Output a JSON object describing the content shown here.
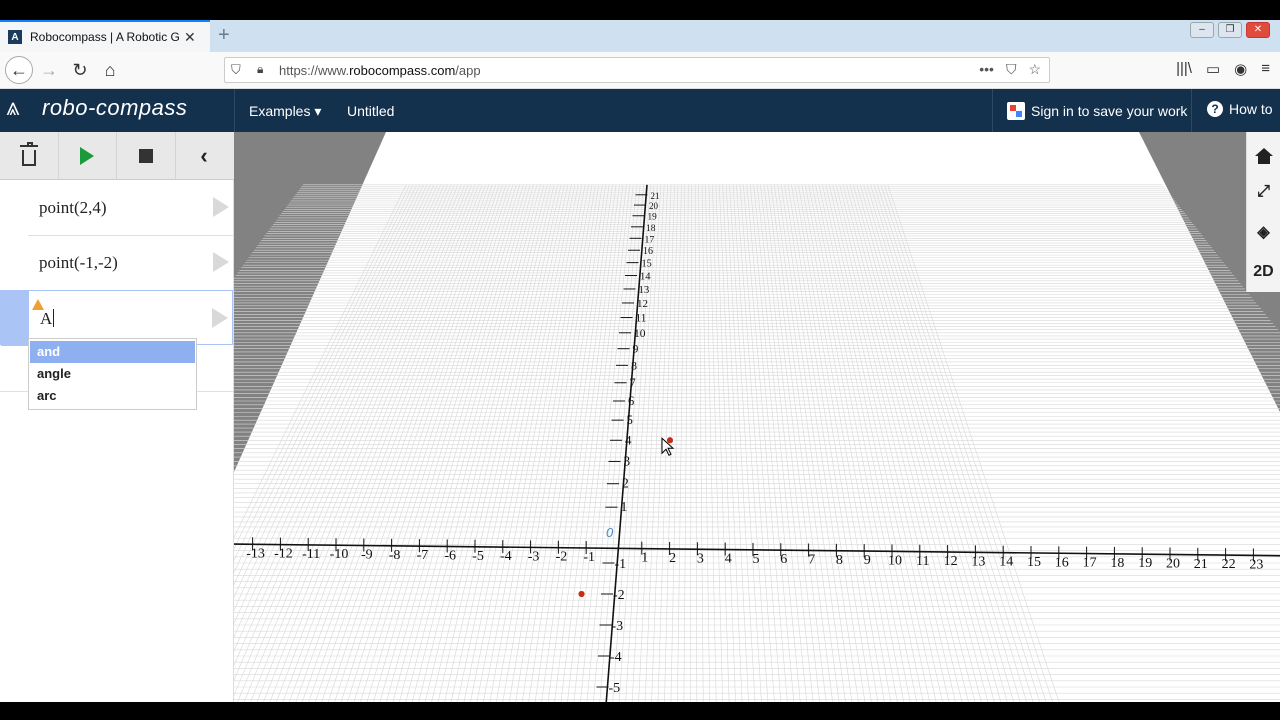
{
  "browser": {
    "tab_title": "Robocompass | A Robotic Geom",
    "tab_close": "✕",
    "new_tab": "+",
    "url_prefix": "https://www.",
    "url_domain": "robocompass.com",
    "url_path": "/app",
    "icons": [
      "back-arrow-icon",
      "forward-arrow-icon",
      "reload-icon",
      "home-icon",
      "shield-icon",
      "lock-icon",
      "more-icon",
      "pocket-icon",
      "star-icon",
      "library-icon",
      "sidebar-icon",
      "account-icon",
      "menu-icon"
    ]
  },
  "app": {
    "logo_text": "robo-compass",
    "examples_label": "Examples ▾",
    "document_title": "Untitled",
    "signin_label": "Sign in to save your work",
    "howto_label": "How to"
  },
  "commands": [
    {
      "code": "point(2,4)"
    },
    {
      "code": "point(-1,-2)"
    },
    {
      "code": "A"
    }
  ],
  "autocomplete": [
    "and",
    "angle",
    "arc"
  ],
  "viewport": {
    "origin_label": "0",
    "view_mode_label": "2D",
    "x_ticks": [
      "-13",
      "-12",
      "-11",
      "-10",
      "-9",
      "-8",
      "-7",
      "-6",
      "-5",
      "-4",
      "-3",
      "-2",
      "-1",
      "1",
      "2",
      "3",
      "4",
      "5",
      "6",
      "7",
      "8",
      "9",
      "10",
      "11",
      "12",
      "13",
      "14",
      "15",
      "16",
      "17",
      "18",
      "19",
      "20",
      "21",
      "22",
      "23"
    ],
    "y_ticks_pos": [
      "1",
      "2",
      "3",
      "4",
      "5",
      "6",
      "7",
      "8",
      "9",
      "10",
      "11",
      "12",
      "13",
      "14",
      "15",
      "16",
      "17",
      "18",
      "19",
      "20",
      "21"
    ],
    "y_ticks_neg": [
      "-1",
      "-2",
      "-3",
      "-4",
      "-5"
    ],
    "points": [
      {
        "x": 2,
        "y": 4
      },
      {
        "x": -1,
        "y": -2
      }
    ],
    "point_color": "#c0301a",
    "origin_color": "#4a8ac8"
  }
}
